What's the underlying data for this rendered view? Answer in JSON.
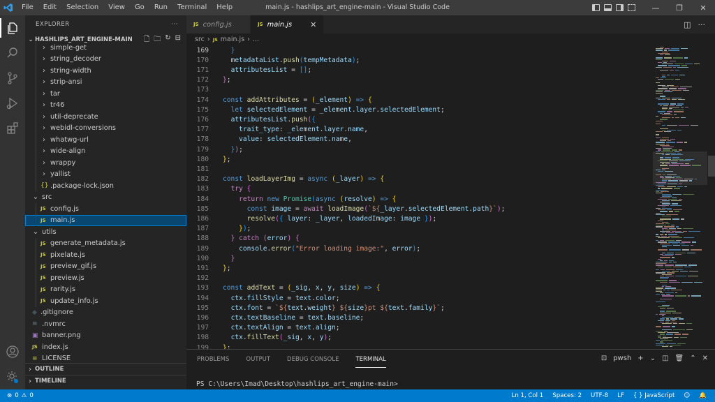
{
  "titlebar": {
    "menu": [
      "File",
      "Edit",
      "Selection",
      "View",
      "Go",
      "Run",
      "Terminal",
      "Help"
    ],
    "title": "main.js - hashlips_art_engine-main - Visual Studio Code",
    "controls": {
      "minimize": "—",
      "restore": "❐",
      "close": "✕"
    }
  },
  "sidebar": {
    "header": "EXPLORER",
    "more": "···",
    "project": "HASHLIPS_ART_ENGINE-MAIN",
    "tree": [
      {
        "label": "simple-get",
        "type": "folder",
        "indent": 1
      },
      {
        "label": "string_decoder",
        "type": "folder",
        "indent": 1
      },
      {
        "label": "string-width",
        "type": "folder",
        "indent": 1
      },
      {
        "label": "strip-ansi",
        "type": "folder",
        "indent": 1
      },
      {
        "label": "tar",
        "type": "folder",
        "indent": 1
      },
      {
        "label": "tr46",
        "type": "folder",
        "indent": 1
      },
      {
        "label": "util-deprecate",
        "type": "folder",
        "indent": 1
      },
      {
        "label": "webidl-conversions",
        "type": "folder",
        "indent": 1
      },
      {
        "label": "whatwg-url",
        "type": "folder",
        "indent": 1
      },
      {
        "label": "wide-align",
        "type": "folder",
        "indent": 1
      },
      {
        "label": "wrappy",
        "type": "folder",
        "indent": 1
      },
      {
        "label": "yallist",
        "type": "folder",
        "indent": 1
      },
      {
        "label": ".package-lock.json",
        "type": "json",
        "indent": 1
      },
      {
        "label": "src",
        "type": "folder-open",
        "indent": 0
      },
      {
        "label": "config.js",
        "type": "js",
        "indent": 1
      },
      {
        "label": "main.js",
        "type": "js",
        "indent": 1,
        "selected": true
      },
      {
        "label": "utils",
        "type": "folder-open",
        "indent": 0
      },
      {
        "label": "generate_metadata.js",
        "type": "js",
        "indent": 1
      },
      {
        "label": "pixelate.js",
        "type": "js",
        "indent": 1
      },
      {
        "label": "preview_gif.js",
        "type": "js",
        "indent": 1
      },
      {
        "label": "preview.js",
        "type": "js",
        "indent": 1
      },
      {
        "label": "rarity.js",
        "type": "js",
        "indent": 1
      },
      {
        "label": "update_info.js",
        "type": "js",
        "indent": 1
      },
      {
        "label": ".gitignore",
        "type": "git",
        "indent": 0
      },
      {
        "label": ".nvmrc",
        "type": "plain",
        "indent": 0
      },
      {
        "label": "banner.png",
        "type": "img",
        "indent": 0
      },
      {
        "label": "index.js",
        "type": "js",
        "indent": 0
      },
      {
        "label": "LICENSE",
        "type": "lic",
        "indent": 0
      }
    ],
    "outline": "OUTLINE",
    "timeline": "TIMELINE"
  },
  "tabs": [
    {
      "label": "config.js",
      "active": false
    },
    {
      "label": "main.js",
      "active": true,
      "close": "✕"
    }
  ],
  "breadcrumb": {
    "folder": "src",
    "file": "main.js",
    "rest": "..."
  },
  "code": {
    "current_line": 169,
    "lines": [
      {
        "n": 169,
        "html": "  <span class='b3'>}</span>"
      },
      {
        "n": 170,
        "html": "  <span class='v'>metadataList</span>.<span class='f'>push</span><span class='b3'>(</span><span class='v'>tempMetadata</span><span class='b3'>)</span>;"
      },
      {
        "n": 171,
        "html": "  <span class='v'>attributesList</span> = <span class='b3'>[]</span>;"
      },
      {
        "n": 172,
        "html": "<span class='b2'>}</span>;"
      },
      {
        "n": 173,
        "html": ""
      },
      {
        "n": 174,
        "html": "<span class='k'>const</span> <span class='f'>addAttributes</span> = <span class='b1'>(</span><span class='v'>_element</span><span class='b1'>)</span> <span class='k'>=&gt;</span> <span class='b1'>{</span>"
      },
      {
        "n": 175,
        "html": "  <span class='k'>let</span> <span class='v'>selectedElement</span> = <span class='v'>_element</span>.<span class='v'>layer</span>.<span class='v'>selectedElement</span>;"
      },
      {
        "n": 176,
        "html": "  <span class='v'>attributesList</span>.<span class='f'>push</span><span class='b2'>(</span><span class='b3'>{</span>"
      },
      {
        "n": 177,
        "html": "    <span class='v'>trait_type</span>: <span class='v'>_element</span>.<span class='v'>layer</span>.<span class='v'>name</span>,"
      },
      {
        "n": 178,
        "html": "    <span class='v'>value</span>: <span class='v'>selectedElement</span>.<span class='v'>name</span>,"
      },
      {
        "n": 179,
        "html": "  <span class='b3'>}</span><span class='b2'>)</span>;"
      },
      {
        "n": 180,
        "html": "<span class='b1'>}</span>;"
      },
      {
        "n": 181,
        "html": ""
      },
      {
        "n": 182,
        "html": "<span class='k'>const</span> <span class='f'>loadLayerImg</span> = <span class='k'>async</span> <span class='b1'>(</span><span class='v'>_layer</span><span class='b1'>)</span> <span class='k'>=&gt;</span> <span class='b1'>{</span>"
      },
      {
        "n": 183,
        "html": "  <span class='c'>try</span> <span class='b2'>{</span>"
      },
      {
        "n": 184,
        "html": "    <span class='c'>return</span> <span class='k'>new</span> <span class='cl'>Promise</span><span class='b3'>(</span><span class='k'>async</span> <span class='b1'>(</span><span class='v'>resolve</span><span class='b1'>)</span> <span class='k'>=&gt;</span> <span class='b1'>{</span>"
      },
      {
        "n": 185,
        "html": "      <span class='k'>const</span> <span class='v'>image</span> = <span class='c'>await</span> <span class='f'>loadImage</span><span class='b2'>(</span><span class='s'>`${</span><span class='v'>_layer</span>.<span class='v'>selectedElement</span>.<span class='v'>path</span><span class='s'>}`</span><span class='b2'>)</span>;"
      },
      {
        "n": 186,
        "html": "      <span class='f'>resolve</span><span class='b2'>(</span><span class='b3'>{</span> <span class='v'>layer</span>: <span class='v'>_layer</span>, <span class='v'>loadedImage</span>: <span class='v'>image</span> <span class='b3'>}</span><span class='b2'>)</span>;"
      },
      {
        "n": 187,
        "html": "    <span class='b1'>}</span><span class='b3'>)</span>;"
      },
      {
        "n": 188,
        "html": "  <span class='b2'>}</span> <span class='c'>catch</span> <span class='b2'>(</span><span class='v'>error</span><span class='b2'>)</span> <span class='b2'>{</span>"
      },
      {
        "n": 189,
        "html": "    <span class='v'>console</span>.<span class='f'>error</span><span class='b3'>(</span><span class='s'>\"Error loading image:\"</span>, <span class='v'>error</span><span class='b3'>)</span>;"
      },
      {
        "n": 190,
        "html": "  <span class='b2'>}</span>"
      },
      {
        "n": 191,
        "html": "<span class='b1'>}</span>;"
      },
      {
        "n": 192,
        "html": ""
      },
      {
        "n": 193,
        "html": "<span class='k'>const</span> <span class='f'>addText</span> = <span class='b1'>(</span><span class='v'>_sig</span>, <span class='v'>x</span>, <span class='v'>y</span>, <span class='v'>size</span><span class='b1'>)</span> <span class='k'>=&gt;</span> <span class='b1'>{</span>"
      },
      {
        "n": 194,
        "html": "  <span class='v'>ctx</span>.<span class='v'>fillStyle</span> = <span class='v'>text</span>.<span class='v'>color</span>;"
      },
      {
        "n": 195,
        "html": "  <span class='v'>ctx</span>.<span class='v'>font</span> = <span class='s'>`${</span><span class='v'>text</span>.<span class='v'>weight</span><span class='s'>} ${</span><span class='v'>size</span><span class='s'>}pt ${</span><span class='v'>text</span>.<span class='v'>family</span><span class='s'>}`</span>;"
      },
      {
        "n": 196,
        "html": "  <span class='v'>ctx</span>.<span class='v'>textBaseline</span> = <span class='v'>text</span>.<span class='v'>baseline</span>;"
      },
      {
        "n": 197,
        "html": "  <span class='v'>ctx</span>.<span class='v'>textAlign</span> = <span class='v'>text</span>.<span class='v'>align</span>;"
      },
      {
        "n": 198,
        "html": "  <span class='v'>ctx</span>.<span class='f'>fillText</span><span class='b2'>(</span><span class='v'>_sig</span>, <span class='v'>x</span>, <span class='v'>y</span><span class='b2'>)</span>;"
      },
      {
        "n": 199,
        "html": "<span class='b1'>}</span>;"
      }
    ]
  },
  "panel": {
    "tabs": [
      "PROBLEMS",
      "OUTPUT",
      "DEBUG CONSOLE",
      "TERMINAL"
    ],
    "active_tab": "TERMINAL",
    "shell": "pwsh",
    "add": "+",
    "prompt": "PS C:\\Users\\Imad\\Desktop\\hashlips_art_engine-main>"
  },
  "statusbar": {
    "errors": "0",
    "warnings": "0",
    "position": "Ln 1, Col 1",
    "spaces": "Spaces: 2",
    "encoding": "UTF-8",
    "eol": "LF",
    "language": "JavaScript"
  },
  "colors": {
    "accent": "#007acc",
    "js_icon": "#cbcb41",
    "keyword": "#569cd6",
    "function": "#dcdcaa"
  }
}
